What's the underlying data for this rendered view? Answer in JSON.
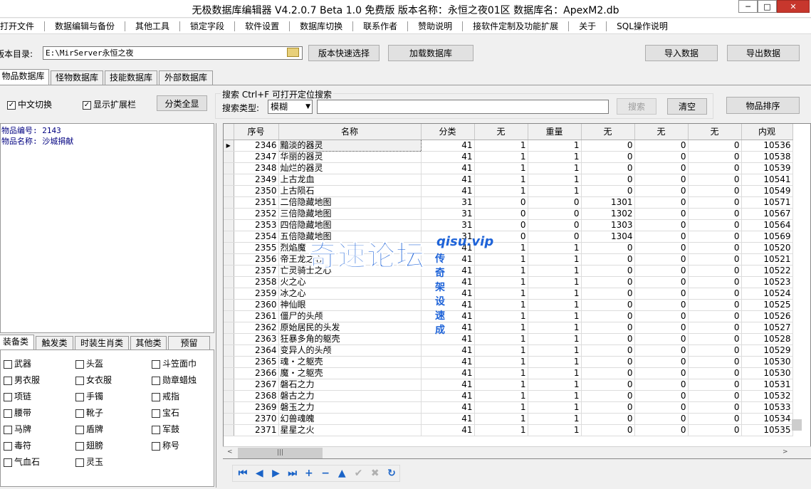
{
  "window": {
    "title": "无极数据库编辑器 V4.2.0.7    Beta 1.0 免费版    版本名称：永恒之夜01区    数据库名：ApexM2.db",
    "min_glyph": "─",
    "max_glyph": "□",
    "close_glyph": "✕"
  },
  "menu": [
    "打开文件",
    "数据编辑与备份",
    "其他工具",
    "锁定字段",
    "软件设置",
    "数据库切换",
    "联系作者",
    "赞助说明",
    "接软件定制及功能扩展",
    "关于",
    "SQL操作说明"
  ],
  "toolbar": {
    "dir_label": "版本目录:",
    "dir_value": "E:\\MirServer永恒之夜",
    "quick_select": "版本快速选择",
    "load_db": "加载数据库",
    "import": "导入数据",
    "export": "导出数据"
  },
  "main_tabs": [
    "物品数据库",
    "怪物数据库",
    "技能数据库",
    "外部数据库"
  ],
  "options": {
    "cn_switch": "中文切换",
    "show_ext": "显示扩展栏",
    "show_all": "分类全显",
    "check_mark": "✓"
  },
  "search": {
    "group_label": "搜索   Ctrl+F 可打开定位搜索",
    "type_label": "搜索类型:",
    "type_value": "模糊",
    "search_btn": "搜索",
    "clear_btn": "清空",
    "sort_btn": "物品排序"
  },
  "info": {
    "item_no": "物品编号: 2143",
    "item_name": "物品名称: 沙城捐献"
  },
  "left_tabs": [
    "装备类",
    "触发类",
    "时装生肖类",
    "其他类",
    "预留"
  ],
  "categories": [
    [
      "武器",
      "头盔",
      "斗笠面巾"
    ],
    [
      "男衣服",
      "女衣服",
      "勋章蜡烛"
    ],
    [
      "项链",
      "手镯",
      "戒指"
    ],
    [
      "腰带",
      "靴子",
      "宝石"
    ],
    [
      "马牌",
      "盾牌",
      "军鼓"
    ],
    [
      "毒符",
      "翅膀",
      "称号"
    ],
    [
      "气血石",
      "灵玉",
      ""
    ]
  ],
  "grid": {
    "columns": [
      "序号",
      "名称",
      "分类",
      "无",
      "重量",
      "无",
      "无",
      "无",
      "内观"
    ],
    "rows": [
      [
        "2346",
        "黯淡的器灵",
        "41",
        "1",
        "1",
        "0",
        "0",
        "0",
        "10536"
      ],
      [
        "2347",
        "华丽的器灵",
        "41",
        "1",
        "1",
        "0",
        "0",
        "0",
        "10538"
      ],
      [
        "2348",
        "灿烂的器灵",
        "41",
        "1",
        "1",
        "0",
        "0",
        "0",
        "10539"
      ],
      [
        "2349",
        "上古龙血",
        "41",
        "1",
        "1",
        "0",
        "0",
        "0",
        "10541"
      ],
      [
        "2350",
        "上古陨石",
        "41",
        "1",
        "1",
        "0",
        "0",
        "0",
        "10549"
      ],
      [
        "2351",
        "二倍隐藏地图",
        "31",
        "0",
        "0",
        "1301",
        "0",
        "0",
        "10571"
      ],
      [
        "2352",
        "三倍隐藏地图",
        "31",
        "0",
        "0",
        "1302",
        "0",
        "0",
        "10567"
      ],
      [
        "2353",
        "四倍隐藏地图",
        "31",
        "0",
        "0",
        "1303",
        "0",
        "0",
        "10564"
      ],
      [
        "2354",
        "五倍隐藏地图",
        "31",
        "0",
        "0",
        "1304",
        "0",
        "0",
        "10569"
      ],
      [
        "2355",
        "烈焰魔",
        "41",
        "1",
        "1",
        "0",
        "0",
        "0",
        "10520"
      ],
      [
        "2356",
        "帝王龙之心",
        "41",
        "1",
        "1",
        "0",
        "0",
        "0",
        "10521"
      ],
      [
        "2357",
        "亡灵骑士之心",
        "41",
        "1",
        "1",
        "0",
        "0",
        "0",
        "10522"
      ],
      [
        "2358",
        "火之心",
        "41",
        "1",
        "1",
        "0",
        "0",
        "0",
        "10523"
      ],
      [
        "2359",
        "冰之心",
        "41",
        "1",
        "1",
        "0",
        "0",
        "0",
        "10524"
      ],
      [
        "2360",
        "神仙眼",
        "41",
        "1",
        "1",
        "0",
        "0",
        "0",
        "10525"
      ],
      [
        "2361",
        "僵尸的头颅",
        "41",
        "1",
        "1",
        "0",
        "0",
        "0",
        "10526"
      ],
      [
        "2362",
        "原始居民的头发",
        "41",
        "1",
        "1",
        "0",
        "0",
        "0",
        "10527"
      ],
      [
        "2363",
        "狂暴多角的躯壳",
        "41",
        "1",
        "1",
        "0",
        "0",
        "0",
        "10528"
      ],
      [
        "2364",
        "变异人的头颅",
        "41",
        "1",
        "1",
        "0",
        "0",
        "0",
        "10529"
      ],
      [
        "2365",
        "魂・之躯壳",
        "41",
        "1",
        "1",
        "0",
        "0",
        "0",
        "10530"
      ],
      [
        "2366",
        "魔・之躯壳",
        "41",
        "1",
        "1",
        "0",
        "0",
        "0",
        "10530"
      ],
      [
        "2367",
        "磐石之力",
        "41",
        "1",
        "1",
        "0",
        "0",
        "0",
        "10531"
      ],
      [
        "2368",
        "磐古之力",
        "41",
        "1",
        "1",
        "0",
        "0",
        "0",
        "10532"
      ],
      [
        "2369",
        "磐玉之力",
        "41",
        "1",
        "1",
        "0",
        "0",
        "0",
        "10533"
      ],
      [
        "2370",
        "幻兽魂魄",
        "41",
        "1",
        "1",
        "0",
        "0",
        "0",
        "10534"
      ],
      [
        "2371",
        "星星之火",
        "41",
        "1",
        "1",
        "0",
        "0",
        "0",
        "10535"
      ]
    ]
  },
  "row_indicator": "▶",
  "scroll": {
    "thumb": "|||",
    "left": "<",
    "right": ">"
  },
  "nav_icons": [
    {
      "name": "first-icon",
      "glyph": "⏮",
      "enabled": true
    },
    {
      "name": "prior-icon",
      "glyph": "◀",
      "enabled": true
    },
    {
      "name": "next-icon",
      "glyph": "▶",
      "enabled": true
    },
    {
      "name": "last-icon",
      "glyph": "⏭",
      "enabled": true
    },
    {
      "name": "insert-icon",
      "glyph": "+",
      "enabled": true
    },
    {
      "name": "delete-icon",
      "glyph": "−",
      "enabled": true
    },
    {
      "name": "edit-icon",
      "glyph": "▲",
      "enabled": true
    },
    {
      "name": "post-icon",
      "glyph": "✔",
      "enabled": false
    },
    {
      "name": "cancel-icon",
      "glyph": "✖",
      "enabled": false
    },
    {
      "name": "refresh-icon",
      "glyph": "↻",
      "enabled": true
    }
  ],
  "watermark": {
    "main": "奇速论坛",
    "site": "qisu.vip",
    "sub": "传奇架设速成"
  }
}
